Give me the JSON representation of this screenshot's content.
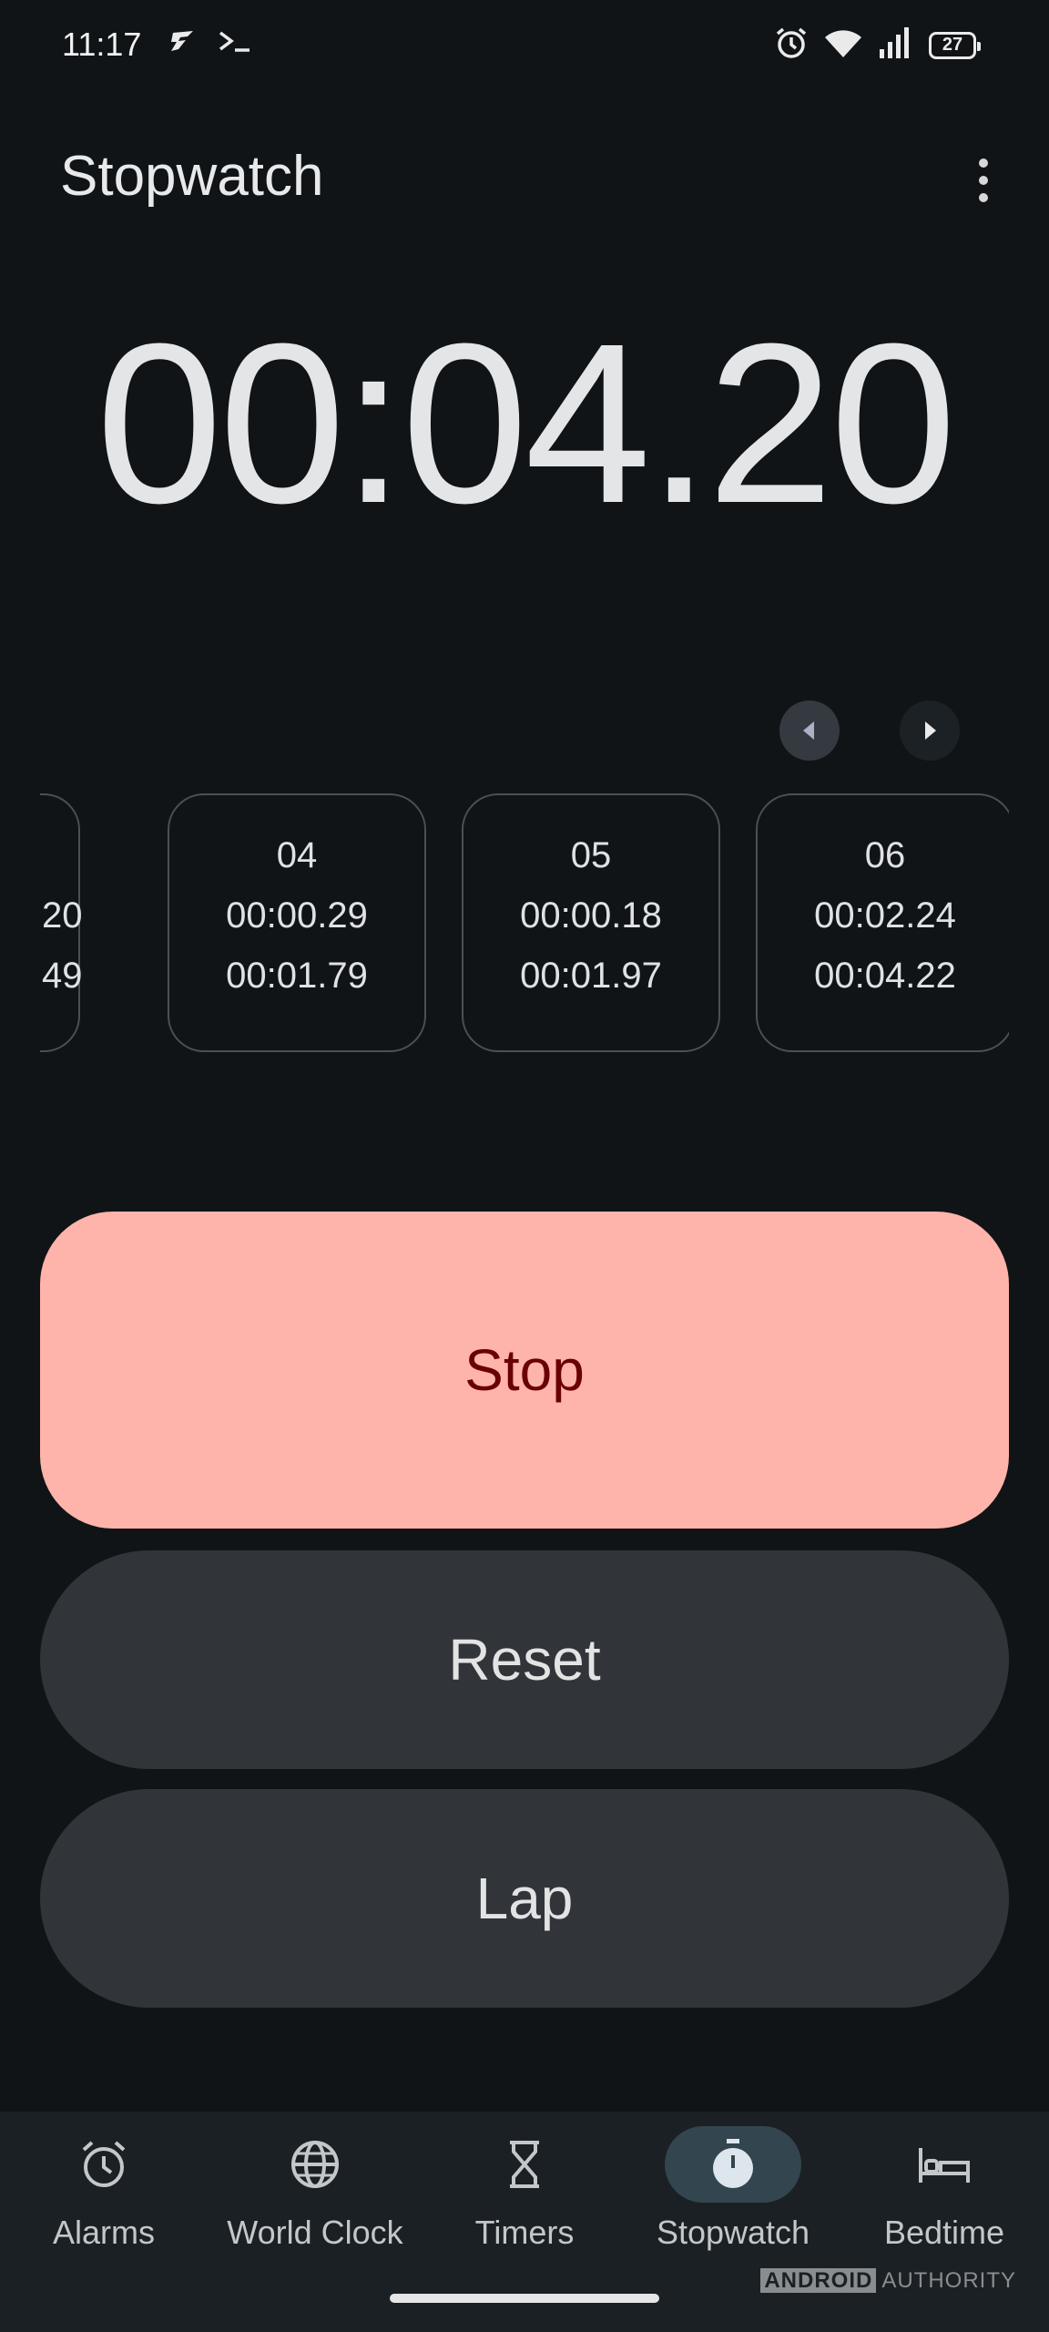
{
  "status_bar": {
    "time": "11:17",
    "battery": "27",
    "icons": [
      "flash-app-icon",
      "terminal-icon",
      "alarm-clock-icon",
      "wifi-icon",
      "signal-icon",
      "battery-icon"
    ]
  },
  "header": {
    "title": "Stopwatch",
    "menu_icon": "more-vert-icon"
  },
  "stopwatch": {
    "elapsed": "00:04.20"
  },
  "lap_navigation": {
    "prev_icon": "chevron-left-icon",
    "next_icon": "chevron-right-icon"
  },
  "laps": {
    "partial": {
      "split": "20",
      "total": "49"
    },
    "items": [
      {
        "number": "04",
        "split": "00:00.29",
        "total": "00:01.79"
      },
      {
        "number": "05",
        "split": "00:00.18",
        "total": "00:01.97"
      },
      {
        "number": "06",
        "split": "00:02.24",
        "total": "00:04.22"
      }
    ]
  },
  "actions": {
    "stop": "Stop",
    "reset": "Reset",
    "lap": "Lap"
  },
  "bottom_nav": {
    "items": [
      {
        "label": "Alarms",
        "icon": "alarm-icon",
        "active": false
      },
      {
        "label": "World Clock",
        "icon": "globe-icon",
        "active": false
      },
      {
        "label": "Timers",
        "icon": "hourglass-icon",
        "active": false
      },
      {
        "label": "Stopwatch",
        "icon": "stopwatch-icon",
        "active": true
      },
      {
        "label": "Bedtime",
        "icon": "bed-icon",
        "active": false
      }
    ]
  },
  "watermark": {
    "brand_box": "ANDROID",
    "brand_text": "AUTHORITY"
  },
  "colors": {
    "background": "#101417",
    "stop_button": "#ffb4ab",
    "stop_text": "#690005",
    "secondary_button": "#31353a",
    "nav_background": "#1b2024",
    "nav_active_pill": "#33454e"
  }
}
